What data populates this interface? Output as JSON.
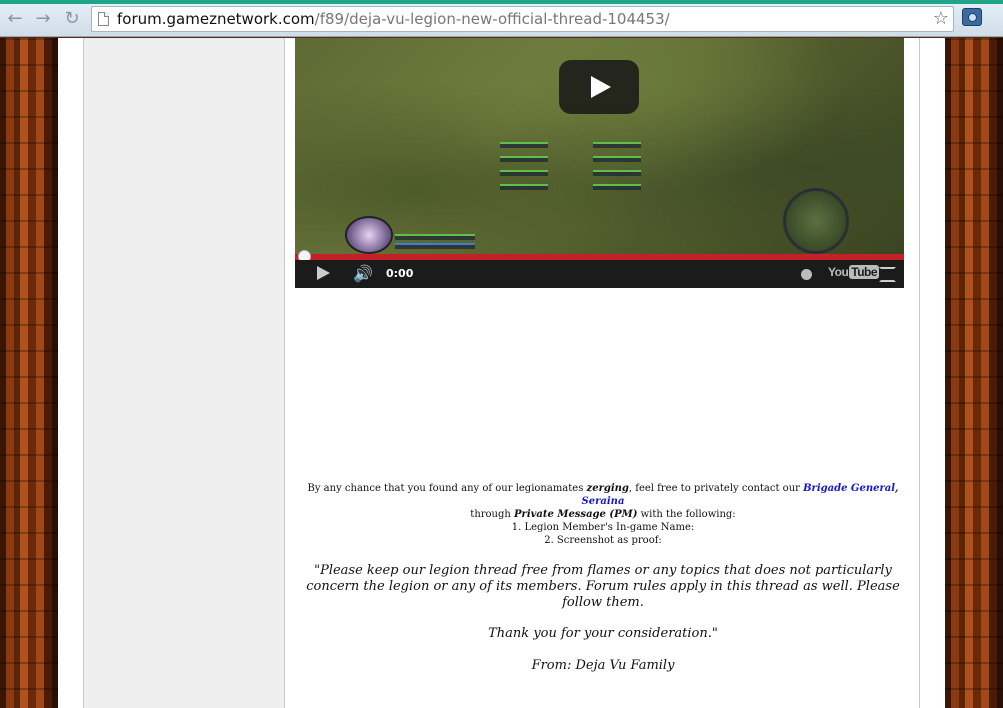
{
  "browser": {
    "url_host": "forum.gameznetwork.com",
    "url_path": "/f89/deja-vu-legion-new-official-thread-104453/",
    "back_icon": "arrow-left-icon",
    "forward_icon": "arrow-right-icon",
    "reload_icon": "reload-icon",
    "star_icon": "star-icon",
    "camera_icon": "camera-icon"
  },
  "video": {
    "current_time": "0:00",
    "youtube_you": "You",
    "youtube_tube": "Tube",
    "progress": 0.0
  },
  "post": {
    "line1_pre": "By any chance that you found any of our legionamates ",
    "line1_em": "zerging",
    "line1_mid": ", feel free to privately contact our ",
    "line1_link": "Brigade General, Seraina",
    "line2_pre": "through ",
    "line2_em": "Private Message (PM)",
    "line2_post": " with the following:",
    "item1": "1. Legion Member's In-game Name:",
    "item2": "2. Screenshot as proof:",
    "quote": "\"Please keep our legion thread free from flames or any topics that does not particularly concern the legion or any of its members. Forum rules apply in this thread as well. Please follow them.",
    "thanks": "Thank you for your consideration.\"",
    "from": "From: Deja Vu Family"
  },
  "colors": {
    "link": "#1414d2",
    "progress": "#c4202a",
    "browser_accent": "#1fa58a"
  }
}
